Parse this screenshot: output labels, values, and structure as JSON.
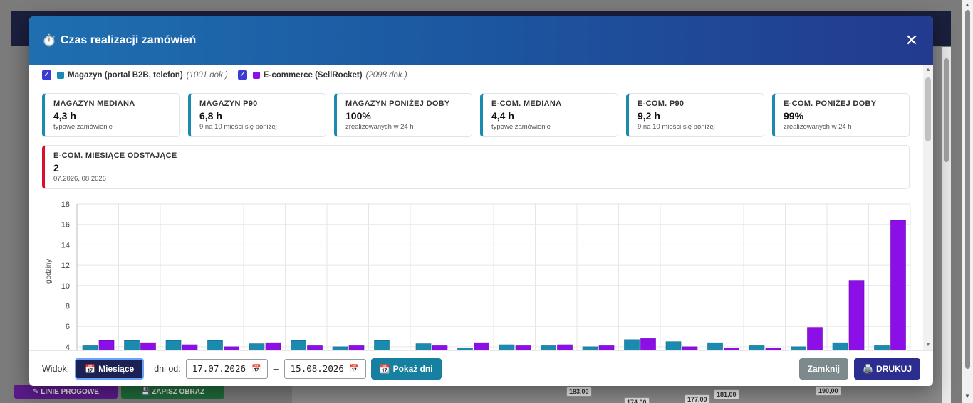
{
  "background": {
    "buttons": [
      "LINIE PROGOWE",
      "ZAPISZ OBRAZ"
    ],
    "bar_labels": [
      "183,00",
      "174,00",
      "177,00",
      "181,00",
      "190,00"
    ]
  },
  "modal": {
    "title_icon": "stopwatch-icon",
    "title": "Czas realizacji zamówień",
    "close_label": "✕"
  },
  "legend": [
    {
      "checked": true,
      "color": "#1a8aae",
      "name": "Magazyn (portal B2B, telefon)",
      "count": "(1001 dok.)"
    },
    {
      "checked": true,
      "color": "#8b0fe6",
      "name": "E-commerce (SellRocket)",
      "count": "(2098 dok.)"
    }
  ],
  "cards": [
    {
      "label": "MAGAZYN MEDIANA",
      "value": "4,3 h",
      "sub": "typowe zamówienie"
    },
    {
      "label": "MAGAZYN P90",
      "value": "6,8 h",
      "sub": "9 na 10 mieści się poniżej"
    },
    {
      "label": "MAGAZYN PONIŻEJ DOBY",
      "value": "100%",
      "sub": "zrealizowanych w 24 h"
    },
    {
      "label": "E-COM. MEDIANA",
      "value": "4,4 h",
      "sub": "typowe zamówienie"
    },
    {
      "label": "E-COM. P90",
      "value": "9,2 h",
      "sub": "9 na 10 mieści się poniżej"
    },
    {
      "label": "E-COM. PONIŻEJ DOBY",
      "value": "99%",
      "sub": "zrealizowanych w 24 h"
    },
    {
      "label": "E-COM. MIESIĄCE ODSTAJĄCE",
      "value": "2",
      "sub": "07.2026, 08.2026"
    }
  ],
  "chart_data": {
    "type": "bar",
    "ylabel": "godziny",
    "ylim": [
      0,
      18
    ],
    "yticks": [
      4,
      6,
      8,
      10,
      12,
      14,
      16,
      18
    ],
    "colors": {
      "magazyn": "#1a8aae",
      "ecom": "#8b0fe6"
    },
    "series": [
      {
        "key": "magazyn",
        "values": [
          4.1,
          4.6,
          4.6,
          4.6,
          4.3,
          4.6,
          4.0,
          4.6,
          4.3,
          3.9,
          4.2,
          4.1,
          4.0,
          4.7,
          4.5,
          4.4,
          4.1,
          4.0,
          4.4,
          4.1
        ]
      },
      {
        "key": "ecom",
        "values": [
          4.6,
          4.4,
          4.2,
          4.0,
          4.4,
          4.1,
          4.1,
          0,
          4.1,
          4.4,
          4.1,
          4.2,
          4.1,
          4.8,
          4.0,
          3.9,
          3.9,
          5.9,
          10.5,
          16.4
        ]
      }
    ]
  },
  "footer": {
    "view_label": "Widok:",
    "months_button": "Miesiące",
    "days_from_label": "dni od:",
    "date_from": "17.07.2026",
    "dash": "–",
    "date_to": "15.08.2026",
    "show_days_button": "Pokaż dni",
    "close_button": "Zamknij",
    "print_button": "DRUKUJ"
  }
}
